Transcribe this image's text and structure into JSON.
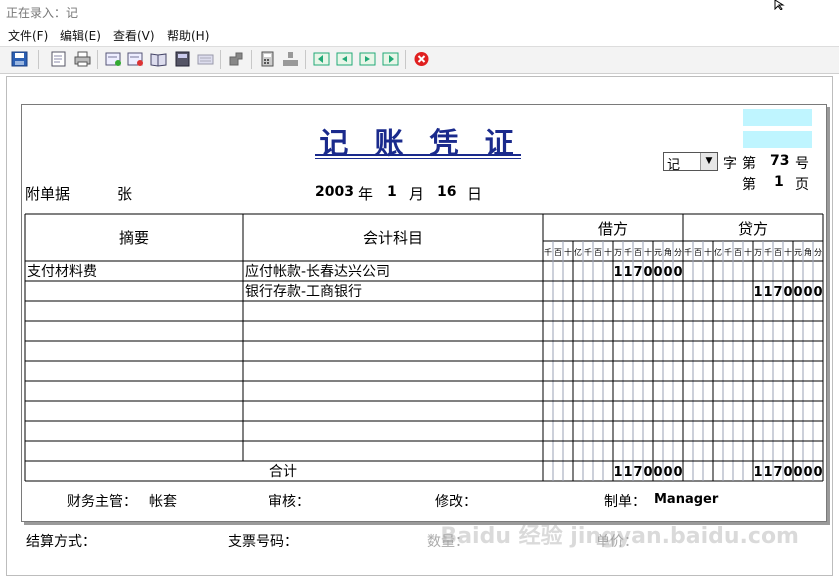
{
  "window": {
    "title": "正在录入：记"
  },
  "menu": [
    "文件(F)",
    "编辑(E)",
    "查看(V)",
    "帮助(H)"
  ],
  "voucher": {
    "title": "记 账 凭 证",
    "type_value": "记",
    "label_zi": "字",
    "label_di": "第",
    "number": "73",
    "label_hao": "号",
    "page_label_di": "第",
    "page": "1",
    "label_ye": "页",
    "attach_label": "附单据",
    "attach_unit": "张",
    "date_year": "2003",
    "label_year": "年",
    "date_month": "1",
    "label_month": "月",
    "date_day": "16",
    "label_day": "日",
    "col_summary": "摘要",
    "col_account": "会计科目",
    "col_debit": "借方",
    "col_credit": "贷方",
    "digit_units": [
      "千",
      "百",
      "十",
      "亿",
      "千",
      "百",
      "十",
      "万",
      "千",
      "百",
      "十",
      "元",
      "角",
      "分"
    ],
    "rows": [
      {
        "summary": "支付材料费",
        "account": "应付帐款-长春达兴公司",
        "debit": "1170000",
        "credit": ""
      },
      {
        "summary": "",
        "account": "银行存款-工商银行",
        "debit": "",
        "credit": "1170000"
      },
      {
        "summary": "",
        "account": "",
        "debit": "",
        "credit": ""
      },
      {
        "summary": "",
        "account": "",
        "debit": "",
        "credit": ""
      },
      {
        "summary": "",
        "account": "",
        "debit": "",
        "credit": ""
      },
      {
        "summary": "",
        "account": "",
        "debit": "",
        "credit": ""
      },
      {
        "summary": "",
        "account": "",
        "debit": "",
        "credit": ""
      },
      {
        "summary": "",
        "account": "",
        "debit": "",
        "credit": ""
      },
      {
        "summary": "",
        "account": "",
        "debit": "",
        "credit": ""
      },
      {
        "summary": "",
        "account": "",
        "debit": "",
        "credit": ""
      }
    ],
    "total_label": "合计",
    "total_debit": "1170000",
    "total_credit": "1170000",
    "finance_supervisor_label": "财务主管：",
    "finance_supervisor": "帐套",
    "audit_label": "审核：",
    "modify_label": "修改：",
    "preparer_label": "制单：",
    "preparer": "Manager"
  },
  "bottom": {
    "settlement_label": "结算方式：",
    "cheque_label": "支票号码：",
    "quantity_label": "数量：",
    "unit_price_label": "单价："
  },
  "icons": [
    "save-icon",
    "preview-icon",
    "print-icon",
    "add-voucher-icon",
    "delete-voucher-icon",
    "book-icon",
    "calc-disk-icon",
    "keyboard-icon",
    "puzzle-icon",
    "calculator-icon",
    "flow-icon",
    "first-record-icon",
    "prev-record-icon",
    "next-record-icon",
    "last-record-icon",
    "close-icon"
  ],
  "watermark": "Baidu 经验  jingyan.baidu.com"
}
